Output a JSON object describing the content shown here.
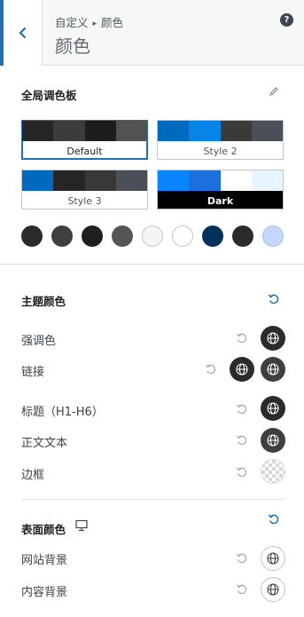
{
  "header": {
    "breadcrumb_parent": "自定义",
    "breadcrumb_sep": "▸",
    "breadcrumb_current": "颜色",
    "title": "颜色",
    "help_label": "?"
  },
  "global_palette": {
    "title": "全局调色板",
    "palettes": [
      {
        "label": "Default",
        "colors": [
          "#262626",
          "#3c3c3c",
          "#1d1d1d",
          "#525252"
        ],
        "active": true
      },
      {
        "label": "Style 2",
        "colors": [
          "#0169be",
          "#0684e8",
          "#3a3a3a",
          "#4b4f58"
        ],
        "active": false
      },
      {
        "label": "Style 3",
        "colors": [
          "#0169be",
          "#262626",
          "#383838",
          "#4b4f58"
        ],
        "active": false
      },
      {
        "label": "Dark",
        "colors": [
          "#0a84ff",
          "#1c6fdc",
          "#ffffff",
          "#e8f4ff"
        ],
        "active": false
      }
    ],
    "swatches": [
      "#2b2b2b",
      "#404040",
      "#1f1f1f",
      "#555555",
      "#f5f5f5",
      "#ffffff",
      "#033159",
      "#2b2b2b",
      "#c5d7ff"
    ]
  },
  "theme_colors": {
    "title": "主题颜色",
    "items": [
      {
        "label": "强调色"
      },
      {
        "label": "链接"
      },
      {
        "label": "标题（H1-H6）"
      },
      {
        "label": "正文文本"
      },
      {
        "label": "边框"
      }
    ]
  },
  "surface_colors": {
    "title": "表面颜色",
    "items": [
      {
        "label": "网站背景"
      },
      {
        "label": "内容背景"
      }
    ]
  },
  "colors": {
    "accent": "#2271b1",
    "icon_reset_active": "#2271b1",
    "icon_reset_muted": "#a7aaad"
  },
  "icons": {
    "back": "chevron-left-icon",
    "help": "help-icon",
    "edit": "pencil-icon",
    "reset": "reset-icon",
    "globe": "globe-icon",
    "monitor": "monitor-icon"
  }
}
